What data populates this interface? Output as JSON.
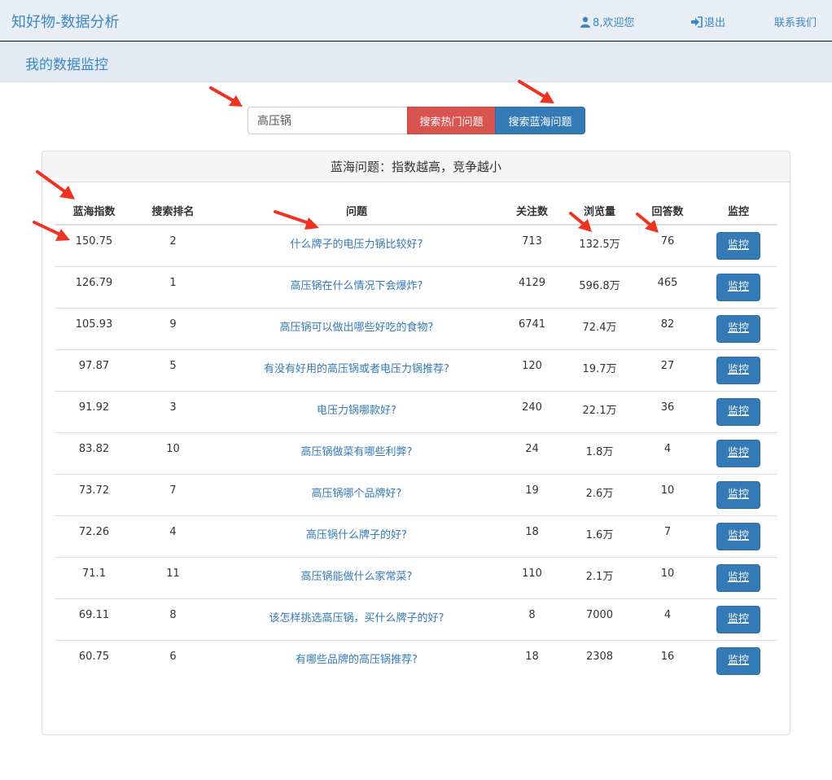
{
  "header": {
    "brand": "知好物-数据分析",
    "user_text": "8,欢迎您",
    "logout_text": "退出",
    "contact_text": "联系我们",
    "icons": [
      "user-icon",
      "logout-icon"
    ]
  },
  "subheader": {
    "title": "我的数据监控"
  },
  "search": {
    "value": "高压锅",
    "hot_button": "搜索热门问题",
    "blue_button": "搜索蓝海问题"
  },
  "panel": {
    "title": "蓝海问题：指数越高，竞争越小",
    "columns": [
      "蓝海指数",
      "搜索排名",
      "问题",
      "关注数",
      "浏览量",
      "回答数",
      "监控"
    ],
    "rows": [
      {
        "index": "150.75",
        "rank": "2",
        "question": "什么牌子的电压力锅比较好?",
        "follow": "713",
        "views": "132.5万",
        "answers": "76",
        "action": "监控"
      },
      {
        "index": "126.79",
        "rank": "1",
        "question": "高压锅在什么情况下会爆炸?",
        "follow": "4129",
        "views": "596.8万",
        "answers": "465",
        "action": "监控"
      },
      {
        "index": "105.93",
        "rank": "9",
        "question": "高压锅可以做出哪些好吃的食物?",
        "follow": "6741",
        "views": "72.4万",
        "answers": "82",
        "action": "监控"
      },
      {
        "index": "97.87",
        "rank": "5",
        "question": "有没有好用的高压锅或者电压力锅推荐?",
        "follow": "120",
        "views": "19.7万",
        "answers": "27",
        "action": "监控"
      },
      {
        "index": "91.92",
        "rank": "3",
        "question": "电压力锅哪款好?",
        "follow": "240",
        "views": "22.1万",
        "answers": "36",
        "action": "监控"
      },
      {
        "index": "83.82",
        "rank": "10",
        "question": "高压锅做菜有哪些利弊?",
        "follow": "24",
        "views": "1.8万",
        "answers": "4",
        "action": "监控"
      },
      {
        "index": "73.72",
        "rank": "7",
        "question": "高压锅哪个品牌好?",
        "follow": "19",
        "views": "2.6万",
        "answers": "10",
        "action": "监控"
      },
      {
        "index": "72.26",
        "rank": "4",
        "question": "高压锅什么牌子的好?",
        "follow": "18",
        "views": "1.6万",
        "answers": "7",
        "action": "监控"
      },
      {
        "index": "71.1",
        "rank": "11",
        "question": "高压锅能做什么家常菜?",
        "follow": "110",
        "views": "2.1万",
        "answers": "10",
        "action": "监控"
      },
      {
        "index": "69.11",
        "rank": "8",
        "question": "该怎样挑选高压锅，买什么牌子的好?",
        "follow": "8",
        "views": "7000",
        "answers": "4",
        "action": "监控"
      },
      {
        "index": "60.75",
        "rank": "6",
        "question": "有哪些品牌的高压锅推荐?",
        "follow": "18",
        "views": "2308",
        "answers": "16",
        "action": "监控"
      }
    ]
  },
  "colors": {
    "link": "#337ab7",
    "danger": "#d9534f",
    "primary": "#337ab7",
    "navbar_bg": "#e9eef5",
    "annotation_arrow": "#ee3322"
  }
}
